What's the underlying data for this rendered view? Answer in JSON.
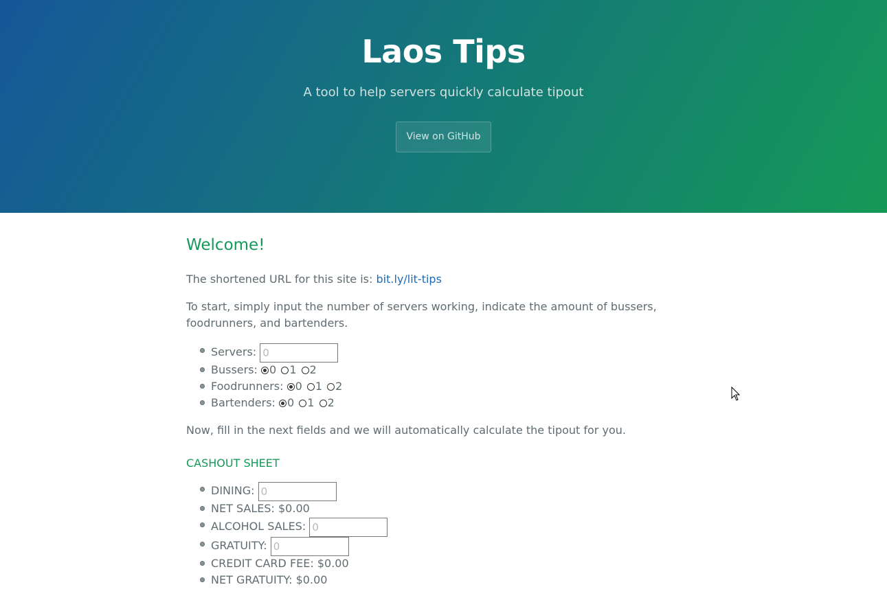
{
  "header": {
    "title": "Laos Tips",
    "tagline": "A tool to help servers quickly calculate tipout",
    "github_button": "View on GitHub"
  },
  "main": {
    "welcome_heading": "Welcome!",
    "short_url_text": "The shortened URL for this site is:",
    "short_url_link": "bit.ly/lit-tips",
    "instructions": "To start, simply input the number of servers working, indicate the amount of bussers, foodrunners, and bartenders.",
    "staff": {
      "servers_label": "Servers:",
      "servers_placeholder": "0",
      "bussers_label": "Bussers:",
      "foodrunners_label": "Foodrunners:",
      "bartenders_label": "Bartenders:",
      "radio_options": [
        "0",
        "1",
        "2"
      ],
      "selected": {
        "bussers": "0",
        "foodrunners": "0",
        "bartenders": "0"
      }
    },
    "next_instructions": "Now, fill in the next fields and we will automatically calculate the tipout for you.",
    "cashout": {
      "heading": "CASHOUT SHEET",
      "dining_label": "DINING:",
      "dining_placeholder": "0",
      "net_sales_label": "NET SALES:",
      "net_sales_value": "$0.00",
      "alcohol_label": "ALCOHOL SALES:",
      "alcohol_placeholder": "0",
      "gratuity_label": "GRATUITY:",
      "gratuity_placeholder": "0",
      "cc_fee_label": "CREDIT CARD FEE:",
      "cc_fee_value": "$0.00",
      "net_gratuity_label": "NET GRATUITY:",
      "net_gratuity_value": "$0.00"
    }
  },
  "colors": {
    "header_gradient_start": "#155799",
    "header_gradient_end": "#159957",
    "heading_green": "#159957",
    "link_blue": "#1e6bb8",
    "body_text": "#606c71"
  }
}
